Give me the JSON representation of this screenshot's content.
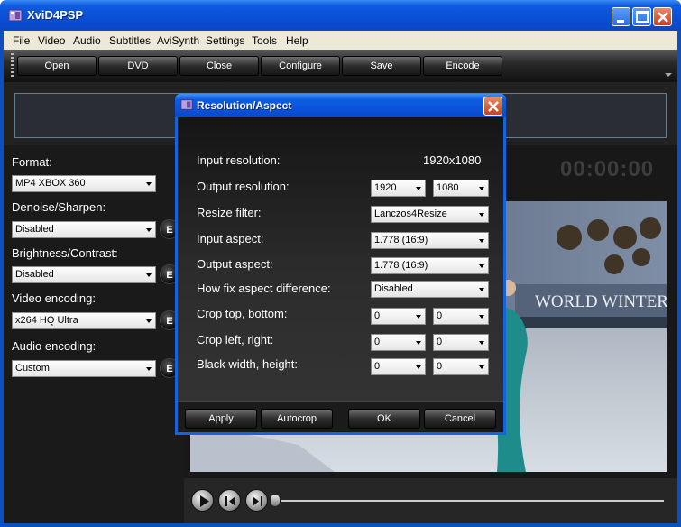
{
  "app": {
    "title": "XviD4PSP",
    "colors": {
      "titlebar": "#0a4fd6",
      "background": "#181818",
      "text": "#ffffff"
    }
  },
  "menu": [
    "File",
    "Video",
    "Audio",
    "Subtitles",
    "AviSynth",
    "Settings",
    "Tools",
    "Help"
  ],
  "toolbar": {
    "buttons": [
      "Open",
      "DVD",
      "Close",
      "Configure",
      "Save",
      "Encode"
    ]
  },
  "left_panel": {
    "format_label": "Format:",
    "format_value": "MP4 XBOX 360",
    "denoise_label": "Denoise/Sharpen:",
    "denoise_value": "Disabled",
    "brightness_label": "Brightness/Contrast:",
    "brightness_value": "Disabled",
    "video_label": "Video encoding:",
    "video_value": "x264 HQ Ultra",
    "audio_label": "Audio encoding:",
    "audio_value": "Custom",
    "edit_button": "E"
  },
  "preview": {
    "timecode": "00:00:00",
    "banner_text": "WORLD WINTERS"
  },
  "dialog": {
    "title": "Resolution/Aspect",
    "rows": {
      "input_resolution": {
        "label": "Input resolution:",
        "value": "1920x1080"
      },
      "output_resolution": {
        "label": "Output resolution:",
        "width": "1920",
        "height": "1080"
      },
      "resize_filter": {
        "label": "Resize filter:",
        "value": "Lanczos4Resize"
      },
      "input_aspect": {
        "label": "Input aspect:",
        "value": "1.778 (16:9)"
      },
      "output_aspect": {
        "label": "Output aspect:",
        "value": "1.778 (16:9)"
      },
      "aspect_fix": {
        "label": "How fix aspect difference:",
        "value": "Disabled"
      },
      "crop_tb": {
        "label": "Crop top, bottom:",
        "a": "0",
        "b": "0"
      },
      "crop_lr": {
        "label": "Crop left, right:",
        "a": "0",
        "b": "0"
      },
      "black": {
        "label": "Black width, height:",
        "a": "0",
        "b": "0"
      }
    },
    "buttons": {
      "apply": "Apply",
      "autocrop": "Autocrop",
      "ok": "OK",
      "cancel": "Cancel"
    }
  }
}
